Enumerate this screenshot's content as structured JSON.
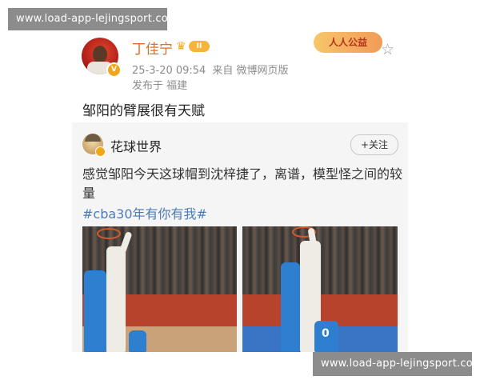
{
  "watermark": {
    "top": "www.load-app-lejingsport.com",
    "bottom": "www.load-app-lejingsport.com"
  },
  "post": {
    "username": "丁佳宁",
    "level_badge": "II",
    "verified_badge": "V",
    "timestamp": "25-3-20 09:54",
    "source": "来自 微博网页版",
    "location": "发布于 福建",
    "charity_badge": "人人公益",
    "text": "邹阳的臂展很有天赋"
  },
  "repost": {
    "author": "花球世界",
    "follow_label": "+关注",
    "text": "感觉邹阳今天这球帽到沈梓捷了，离谱，模型怪之间的较量",
    "hashtag": "#cba30年有你有我#",
    "photo_1": {
      "jersey_number": ""
    },
    "photo_2": {
      "jersey_number": "0"
    }
  },
  "colors": {
    "username": "#e26d23",
    "hashtag": "#4b7bb8",
    "meta_text": "#8c8c8c",
    "repost_bg": "#f5f5f5",
    "watermark_bg": "#8c8c8c"
  },
  "icons": [
    "crown-icon",
    "star-icon",
    "verified-icon"
  ]
}
